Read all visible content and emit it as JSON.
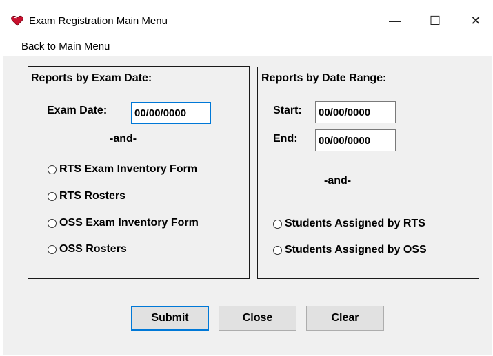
{
  "window": {
    "title": "Exam Registration Main Menu",
    "minimize_glyph": "—",
    "maximize_glyph": "☐",
    "close_glyph": "✕",
    "icon": "heart-app-icon"
  },
  "menubar": {
    "items": [
      {
        "label": "Back to Main Menu"
      }
    ]
  },
  "by_exam_date": {
    "title": "Reports by Exam Date:",
    "exam_date_label": "Exam Date:",
    "exam_date_value": "00/00/0000",
    "and_label": "-and-",
    "options": [
      {
        "label": "RTS Exam Inventory Form",
        "selected": false
      },
      {
        "label": "RTS Rosters",
        "selected": false
      },
      {
        "label": "OSS Exam Inventory Form",
        "selected": false
      },
      {
        "label": "OSS Rosters",
        "selected": false
      }
    ]
  },
  "by_date_range": {
    "title": "Reports by Date Range:",
    "start_label": "Start:",
    "start_value": "00/00/0000",
    "end_label": "End:",
    "end_value": "00/00/0000",
    "and_label": "-and-",
    "options": [
      {
        "label": "Students Assigned by RTS",
        "selected": false
      },
      {
        "label": "Students Assigned by OSS",
        "selected": false
      }
    ]
  },
  "buttons": {
    "submit": "Submit",
    "close": "Close",
    "clear": "Clear"
  },
  "colors": {
    "accent": "#0078d7",
    "client_bg": "#f0f0f0",
    "button_bg": "#e1e1e1"
  }
}
